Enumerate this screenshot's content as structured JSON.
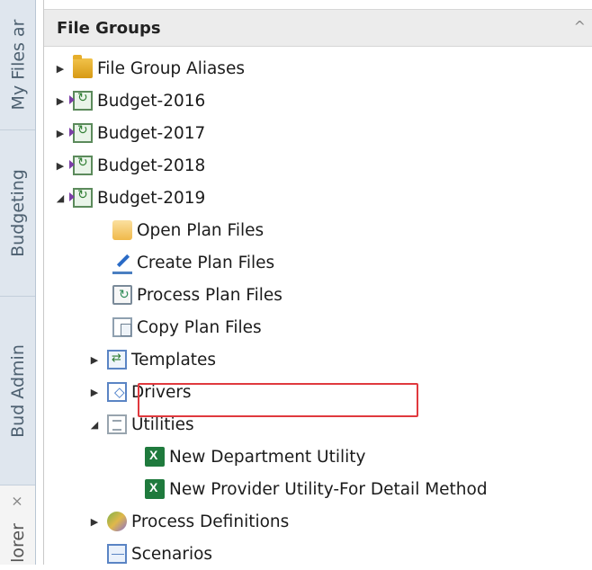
{
  "side_tabs": [
    {
      "label": "My Files ar"
    },
    {
      "label": "Budgeting"
    },
    {
      "label": "Bud Admin"
    },
    {
      "label": "lorer",
      "close": "×"
    }
  ],
  "panel": {
    "title": "File Groups",
    "collapse_glyph": "^"
  },
  "tree": [
    {
      "label": "File Group Aliases",
      "expander": "▶",
      "icon": "folder-icon"
    },
    {
      "label": "Budget-2016",
      "expander": "▶",
      "icon": "file-group-icon"
    },
    {
      "label": "Budget-2017",
      "expander": "▶",
      "icon": "file-group-icon"
    },
    {
      "label": "Budget-2018",
      "expander": "▶",
      "icon": "file-group-icon"
    },
    {
      "label": "Budget-2019",
      "expander": "◢",
      "icon": "file-group-icon"
    },
    {
      "label": "Open Plan Files",
      "icon": "open-folder-icon"
    },
    {
      "label": "Create Plan Files",
      "icon": "create-plan-icon"
    },
    {
      "label": "Process Plan Files",
      "icon": "process-plan-icon"
    },
    {
      "label": "Copy Plan Files",
      "icon": "copy-plan-icon"
    },
    {
      "label": "Templates",
      "expander": "▶",
      "icon": "templates-icon"
    },
    {
      "label": "Drivers",
      "expander": "▶",
      "icon": "drivers-icon"
    },
    {
      "label": "Utilities",
      "expander": "◢",
      "icon": "utilities-icon"
    },
    {
      "label": "New Department Utility",
      "icon": "excel-icon"
    },
    {
      "label": "New Provider Utility-For Detail Method",
      "icon": "excel-icon"
    },
    {
      "label": "Process Definitions",
      "expander": "▶",
      "icon": "process-definitions-icon"
    },
    {
      "label": "Scenarios",
      "icon": "scenarios-icon"
    }
  ],
  "colors": {
    "highlight_border": "#e0393e",
    "tab_strip": "#dfe6ee",
    "header_bg": "#ececec"
  }
}
